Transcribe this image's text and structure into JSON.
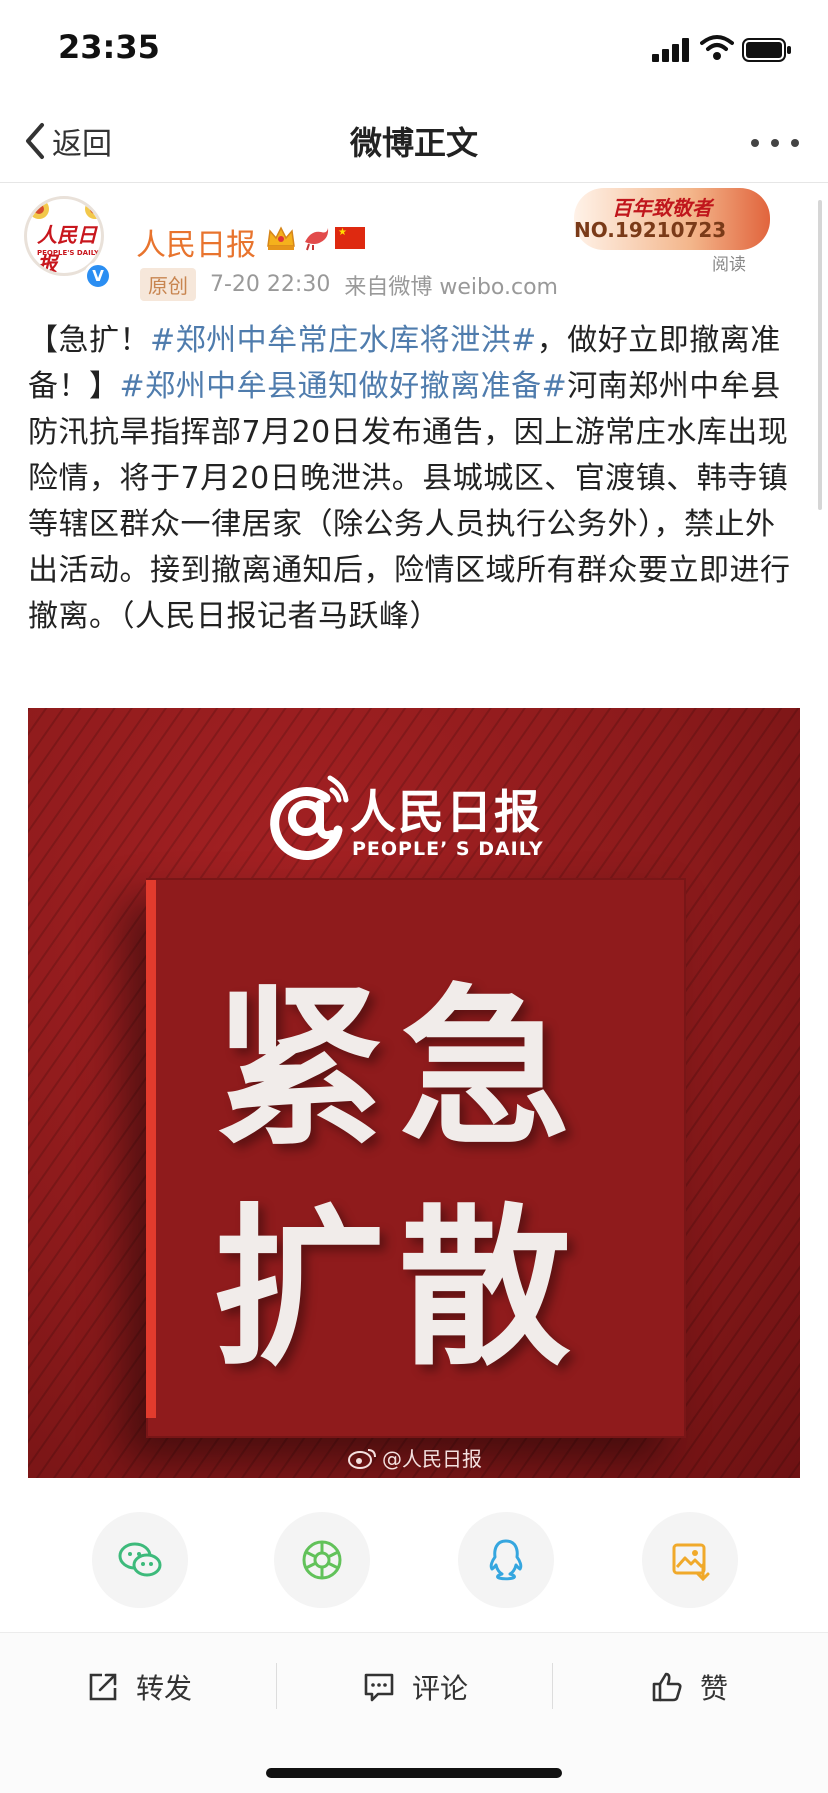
{
  "status_bar": {
    "time": "23:35"
  },
  "nav": {
    "back_label": "返回",
    "title": "微博正文"
  },
  "post": {
    "username": "人民日报",
    "original_badge": "原创",
    "time": "7-20 22:30",
    "source": "来自微博 weibo.com",
    "reward_title": "百年致敬者",
    "reward_number": "NO.19210723",
    "reads_label": "阅读",
    "avatar_logo": "人民日报",
    "avatar_sub": "PEOPLE'S DAILY",
    "text_segments": [
      {
        "t": "【急扩！",
        "tag": false
      },
      {
        "t": "#郑州中牟常庄水库将泄洪#",
        "tag": true
      },
      {
        "t": "，做好立即撤离准备！】",
        "tag": false
      },
      {
        "t": "#郑州中牟县通知做好撤离准备#",
        "tag": true
      },
      {
        "t": "河南郑州中牟县防汛抗旱指挥部7月20日发布通告，因上游常庄水库出现险情，将于7月20日晚泄洪。县城城区、官渡镇、韩寺镇等辖区群众一律居家（除公务人员执行公务外），禁止外出活动。接到撤离通知后，险情区域所有群众要立即进行撤离。（人民日报记者马跃峰）",
        "tag": false
      }
    ]
  },
  "poster": {
    "logo_cn": "人民日报",
    "logo_en": "PEOPLE’ S DAILY",
    "line1": "紧急",
    "line2": "扩散",
    "watermark": "@人民日报"
  },
  "share": [
    "wechat-icon",
    "moments-icon",
    "qq-icon",
    "save-image-icon"
  ],
  "actions": {
    "repost": "转发",
    "comment": "评论",
    "like": "赞"
  },
  "colors": {
    "username": "#e8742e",
    "tag": "#4f7cad",
    "poster_red": "#8e1c1d",
    "accent_line": "#e23b2d"
  }
}
